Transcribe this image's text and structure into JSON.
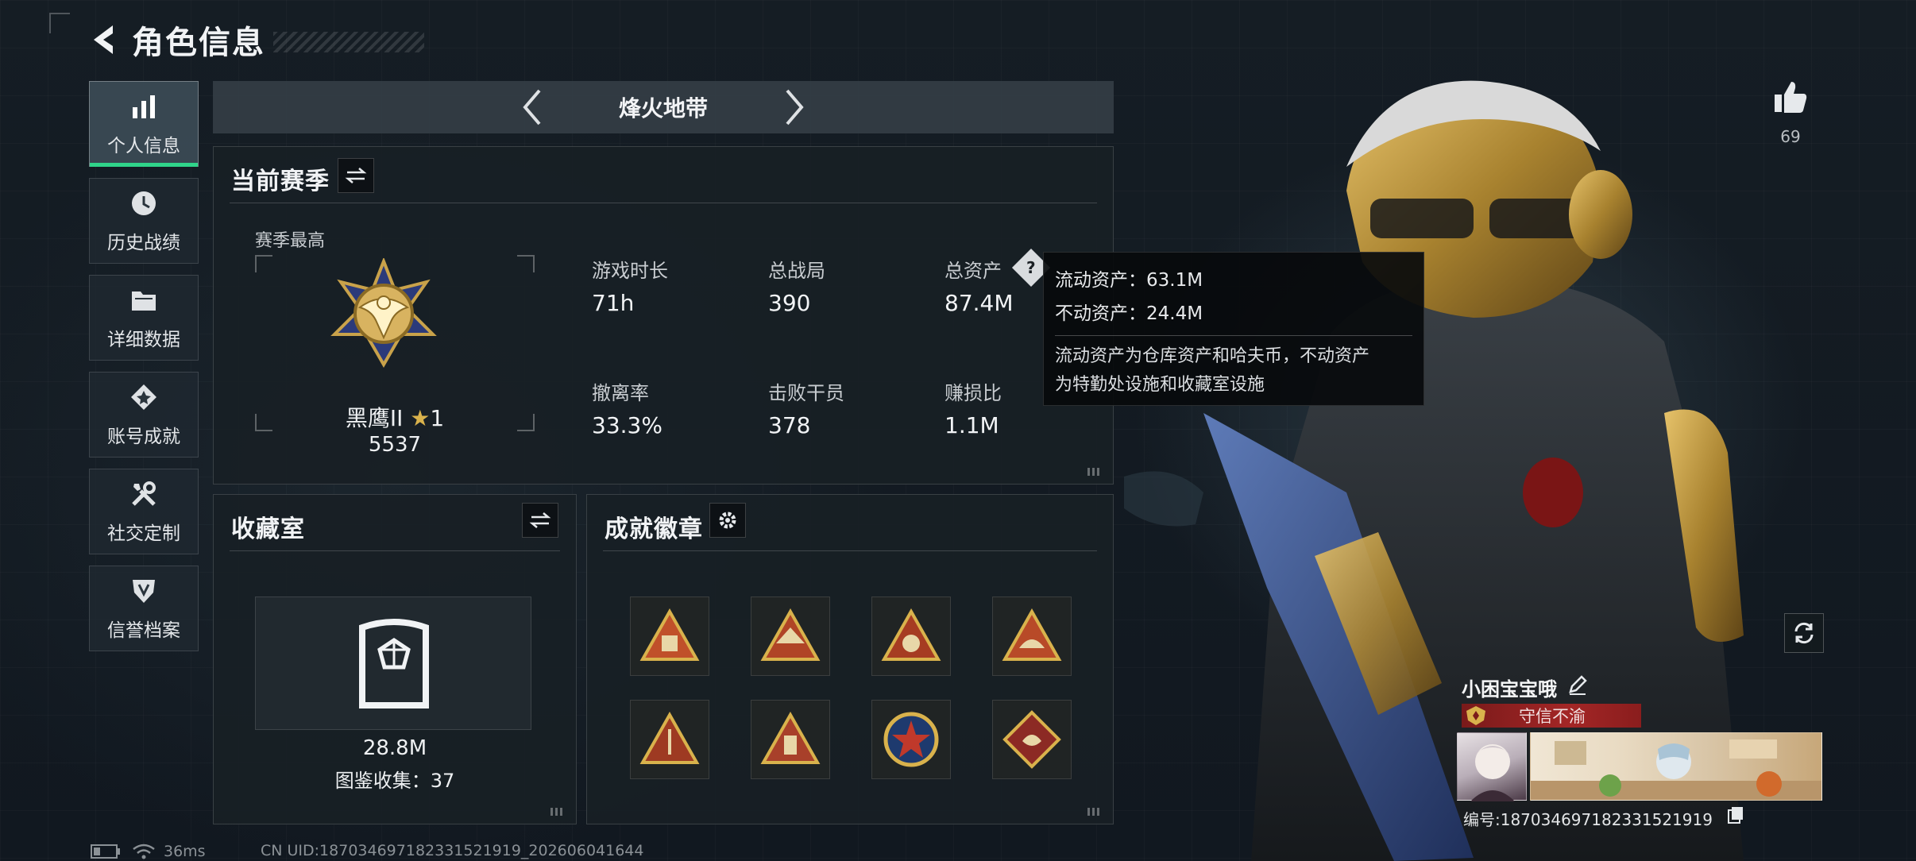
{
  "header": {
    "title": "角色信息"
  },
  "sidebar": {
    "items": [
      {
        "label": "个人信息",
        "icon": "bar-chart-icon",
        "active": true
      },
      {
        "label": "历史战绩",
        "icon": "history-icon",
        "active": false
      },
      {
        "label": "详细数据",
        "icon": "folder-icon",
        "active": false
      },
      {
        "label": "账号成就",
        "icon": "achievement-icon",
        "active": false
      },
      {
        "label": "社交定制",
        "icon": "tools-icon",
        "active": false
      },
      {
        "label": "信誉档案",
        "icon": "credit-shield-icon",
        "active": false
      }
    ]
  },
  "mode": {
    "name": "烽火地带"
  },
  "season": {
    "title": "当前赛季",
    "best_label": "赛季最高",
    "rank_name": "黑鹰II",
    "rank_stars": "1",
    "rank_points": "5537",
    "stats": [
      {
        "label": "游戏时长",
        "value": "71h"
      },
      {
        "label": "总战局",
        "value": "390"
      },
      {
        "label": "总资产",
        "value": "87.4M"
      },
      {
        "label": "撤离率",
        "value": "33.3%"
      },
      {
        "label": "击败干员",
        "value": "378"
      },
      {
        "label": "赚损比",
        "value": "1.1M"
      }
    ]
  },
  "tooltip": {
    "liquid": "流动资产：63.1M",
    "fixed": "不动资产：24.4M",
    "desc_line1": "流动资产为仓库资产和哈夫币，不动资产",
    "desc_line2": "为特勤处设施和收藏室设施"
  },
  "collection": {
    "title": "收藏室",
    "value": "28.8M",
    "count_text": "图鉴收集：37"
  },
  "achievements": {
    "title": "成就徽章",
    "badges": [
      "triangle-badge-1",
      "triangle-badge-2",
      "triangle-badge-3",
      "triangle-badge-4",
      "triangle-badge-5",
      "triangle-badge-6",
      "round-star-badge",
      "diamond-badge"
    ]
  },
  "profile": {
    "likes": "69",
    "player_name": "小困宝宝哦",
    "honor_title": "守信不渝",
    "player_id": "编号:18703469718233152191​9"
  },
  "status": {
    "ping": "36ms",
    "uid": "CN UID:187034697182331521919_202606041644"
  },
  "colors": {
    "accent_green": "#2fd48a",
    "honor_red": "#a32626",
    "gold": "#c9a24a"
  }
}
